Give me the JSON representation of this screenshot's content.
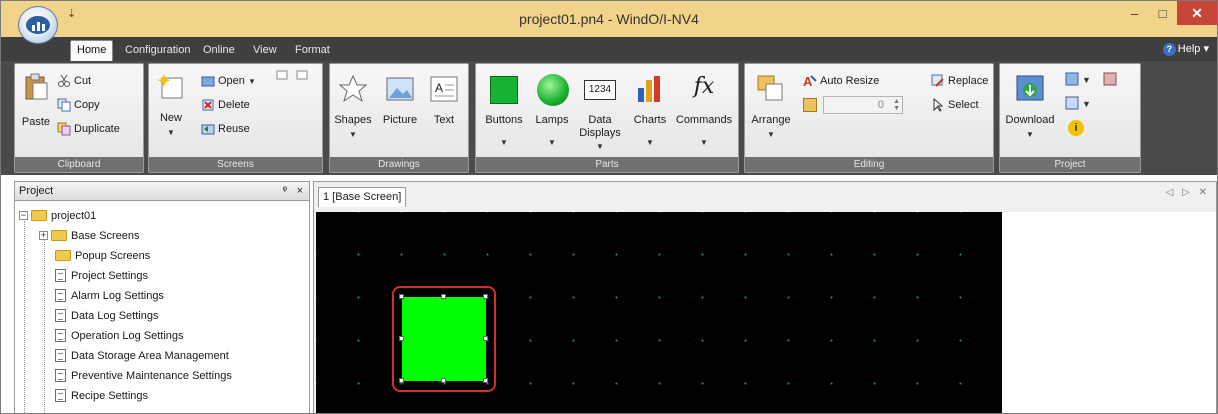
{
  "window": {
    "title": "project01.pn4 - WindO/I-NV4",
    "minimize_label": "–",
    "maximize_label": "□",
    "close_label": "✕"
  },
  "quick_access": {
    "label": "⇣"
  },
  "tabs": [
    {
      "label": "Home",
      "active": true
    },
    {
      "label": "Configuration"
    },
    {
      "label": "Online"
    },
    {
      "label": "View"
    },
    {
      "label": "Format"
    }
  ],
  "help": {
    "label": "Help ▾"
  },
  "ribbon": {
    "clipboard": {
      "caption": "Clipboard",
      "paste": "Paste",
      "cut": "Cut",
      "copy": "Copy",
      "duplicate": "Duplicate"
    },
    "screens": {
      "caption": "Screens",
      "new": "New",
      "open": "Open",
      "delete": "Delete",
      "reuse": "Reuse"
    },
    "drawings": {
      "caption": "Drawings",
      "shapes": "Shapes",
      "picture": "Picture",
      "text": "Text"
    },
    "parts": {
      "caption": "Parts",
      "buttons": "Buttons",
      "lamps": "Lamps",
      "data_displays_1": "Data",
      "data_displays_2": "Displays",
      "data_icon_text": "1234",
      "charts": "Charts",
      "commands": "Commands",
      "fx": "fx"
    },
    "editing": {
      "caption": "Editing",
      "arrange": "Arrange",
      "auto_resize": "Auto Resize",
      "replace": "Replace",
      "select": "Select",
      "spin_value": "0"
    },
    "project": {
      "caption": "Project",
      "download": "Download"
    }
  },
  "project_panel": {
    "title": "Project",
    "pin": "ᵠ",
    "close": "×",
    "tree": [
      {
        "label": "project01",
        "type": "folder",
        "expander": "−"
      },
      {
        "label": "Base Screens",
        "type": "folder",
        "expander": "+"
      },
      {
        "label": "Popup Screens",
        "type": "folder"
      },
      {
        "label": "Project Settings",
        "type": "doc"
      },
      {
        "label": "Alarm Log Settings",
        "type": "doc"
      },
      {
        "label": "Data Log Settings",
        "type": "doc"
      },
      {
        "label": "Operation Log Settings",
        "type": "doc"
      },
      {
        "label": "Data Storage Area Management",
        "type": "doc"
      },
      {
        "label": "Preventive Maintenance Settings",
        "type": "doc"
      },
      {
        "label": "Recipe Settings",
        "type": "doc"
      }
    ]
  },
  "editor": {
    "tab_label": "1  [Base Screen]",
    "controls": "◁ ▷ ✕"
  },
  "colors": {
    "accent": "#d32f2f",
    "part_green": "#00ff00",
    "canvas": "#000000",
    "titlebar": "#f2d38a"
  }
}
